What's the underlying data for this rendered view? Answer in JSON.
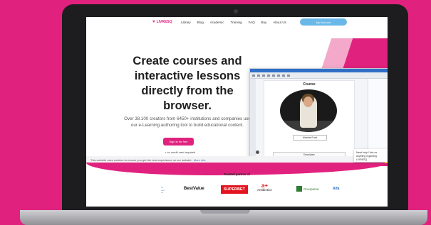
{
  "nav": {
    "brand": "LIVRESQ",
    "items": [
      "Library",
      "Blog",
      "Academic",
      "Training",
      "FAQ",
      "Buy",
      "About Us"
    ],
    "account_button": "My Account"
  },
  "hero": {
    "title": "Create courses and interactive lessons directly from the browser.",
    "subtitle": "Over 38.100 creators from 6450+ institutions and companies use our e-Learning authoring tool to build educational content.",
    "cta": "Sign in for free",
    "note": "no credit card required"
  },
  "editor_preview": {
    "slide_title": "Course",
    "caption": "Website Front",
    "section": "Description"
  },
  "cookie_banner": {
    "text": "This website uses cookies to ensure you get the best experience on our website.",
    "link": "More info"
  },
  "chat": {
    "message": "Need help? Ask us anything regarding LIVRESQ"
  },
  "partners": {
    "heading": "Trusted partner of",
    "logos": [
      "BestValue",
      "SUPERBET",
      "Antibiotice",
      "Groupama",
      "Alfa"
    ]
  },
  "colors": {
    "brand_pink": "#e0227e",
    "account_blue": "#6ab8e8"
  }
}
